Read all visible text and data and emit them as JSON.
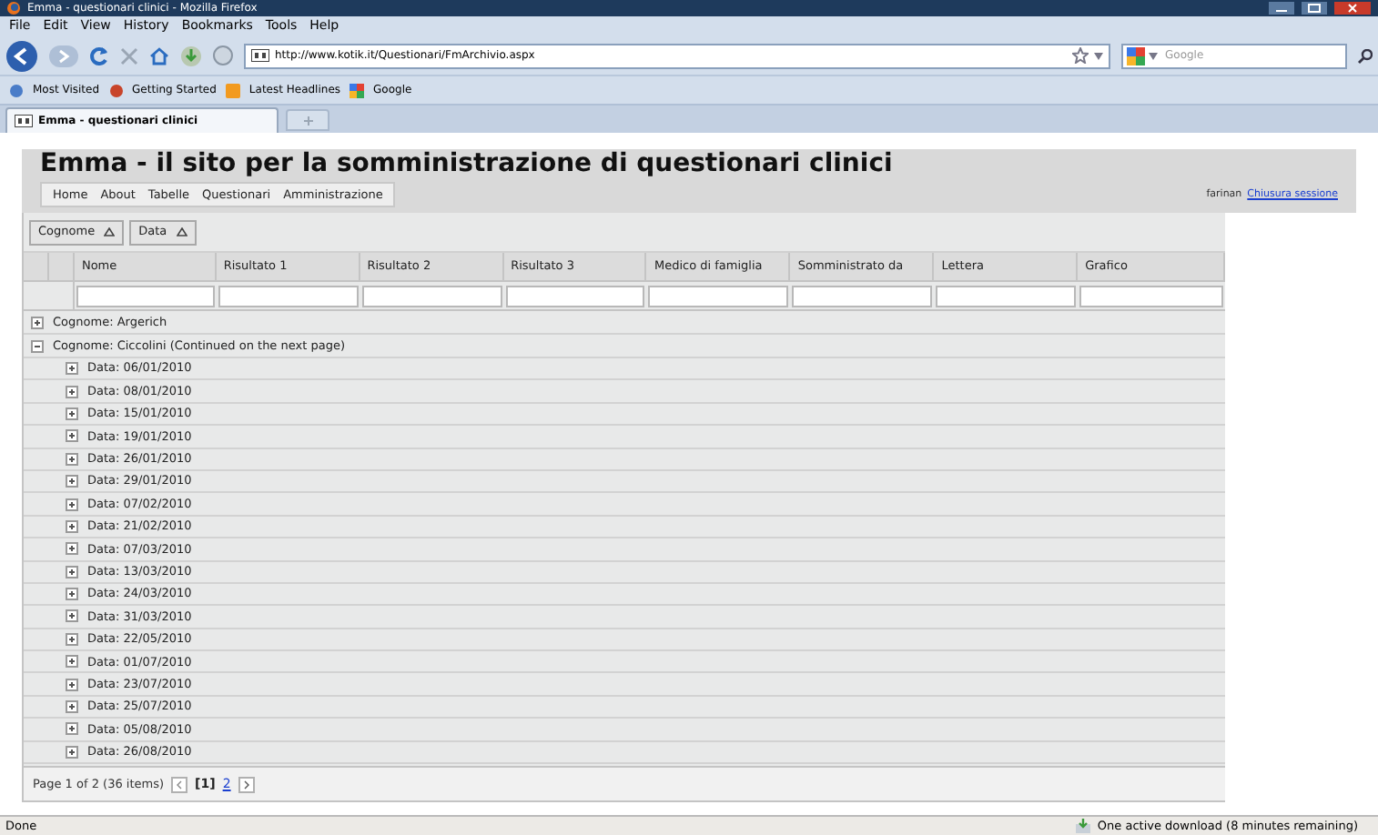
{
  "window": {
    "title": "Emma - questionari clinici - Mozilla Firefox"
  },
  "menu": [
    "File",
    "Edit",
    "View",
    "History",
    "Bookmarks",
    "Tools",
    "Help"
  ],
  "address": {
    "value": "http://www.kotik.it/Questionari/FmArchivio.aspx"
  },
  "search": {
    "placeholder": "Google"
  },
  "bookmarks": [
    "Most Visited",
    "Getting Started",
    "Latest Headlines",
    "Google"
  ],
  "tabs": [
    {
      "label": "Emma - questionari clinici",
      "selected": true
    }
  ],
  "page": {
    "title": "Emma - il sito per la somministrazione di questionari clinici",
    "nav": [
      "Home",
      "About",
      "Tabelle",
      "Questionari",
      "Amministrazione"
    ],
    "user": "farinan",
    "logout": "Chiusura sessione"
  },
  "grid": {
    "group_by": [
      "Cognome",
      "Data"
    ],
    "columns": [
      "Nome",
      "Risultato 1",
      "Risultato 2",
      "Risultato 3",
      "Medico di famiglia",
      "Somministrato da",
      "Lettera",
      "Grafico"
    ],
    "groups": [
      {
        "label": "Cognome: Argerich",
        "expanded": false
      },
      {
        "label": "Cognome: Ciccolini (Continued on the next page)",
        "expanded": true,
        "children": [
          {
            "label": "Data: 06/01/2010",
            "expanded": false
          },
          {
            "label": "Data: 08/01/2010",
            "expanded": false
          },
          {
            "label": "Data: 15/01/2010",
            "expanded": false
          },
          {
            "label": "Data: 19/01/2010",
            "expanded": false
          },
          {
            "label": "Data: 26/01/2010",
            "expanded": false
          },
          {
            "label": "Data: 29/01/2010",
            "expanded": false
          },
          {
            "label": "Data: 07/02/2010",
            "expanded": false
          },
          {
            "label": "Data: 21/02/2010",
            "expanded": false
          },
          {
            "label": "Data: 07/03/2010",
            "expanded": false
          },
          {
            "label": "Data: 13/03/2010",
            "expanded": false
          },
          {
            "label": "Data: 24/03/2010",
            "expanded": false
          },
          {
            "label": "Data: 31/03/2010",
            "expanded": false
          },
          {
            "label": "Data: 22/05/2010",
            "expanded": false
          },
          {
            "label": "Data: 01/07/2010",
            "expanded": false
          },
          {
            "label": "Data: 23/07/2010",
            "expanded": false
          },
          {
            "label": "Data: 25/07/2010",
            "expanded": false
          },
          {
            "label": "Data: 05/08/2010",
            "expanded": false
          },
          {
            "label": "Data: 26/08/2010",
            "expanded": false
          }
        ]
      }
    ],
    "pager": {
      "summary": "Page 1 of 2 (36 items)",
      "pages": [
        {
          "label": "[1]",
          "selected": true
        },
        {
          "label": "2",
          "selected": false
        }
      ]
    }
  },
  "status_bar": {
    "text": "Done",
    "download": "One active download (8 minutes remaining)"
  }
}
